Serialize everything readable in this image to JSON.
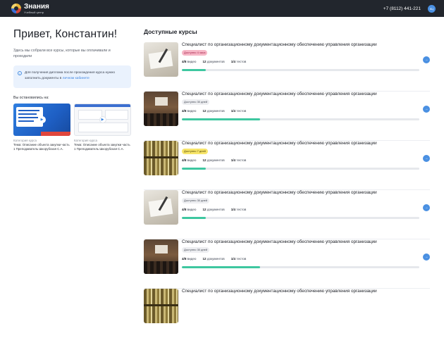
{
  "header": {
    "logo_title": "Знания",
    "logo_subtitle": "Учебный центр",
    "phone": "+7 (8112) 441-221",
    "avatar_initials": "КЦ"
  },
  "sidebar": {
    "greeting": "Привет, Константин!",
    "intro": "Здесь мы собрали все курсы, которые вы оплачивали и проходили",
    "notice_text": "Для получения диплома после прохождения курса нужно заполнить документы в",
    "notice_link": "личном кабинете",
    "stopped_title": "Вы остановились на:",
    "recent": [
      {
        "category": "Категория курса",
        "description": "Тема: Описание объекта закупки часть 1 Преподаватель Шкорубская С.А."
      },
      {
        "category": "Категория курса",
        "description": "Тема: Описание объекта закупки часть 1 Преподаватель Шкорубская С.А."
      }
    ]
  },
  "main": {
    "section_title": "Доступные курсы",
    "courses": [
      {
        "title": "Специалист по организационному документационному обеспечению управления организации",
        "badge": "Доступно 4 часа",
        "videos": "4/8",
        "videos_label": "видео",
        "docs": "12",
        "docs_label": "документов",
        "tests": "1/4",
        "tests_label": "тестов",
        "progress": 0.1
      },
      {
        "title": "Специалист по организационному документационному обеспечению управления организации",
        "badge": "Доступно 30 дней",
        "videos": "4/8",
        "videos_label": "видео",
        "docs": "12",
        "docs_label": "документов",
        "tests": "1/4",
        "tests_label": "тестов",
        "progress": 0.33
      },
      {
        "title": "Специалист по организационному документационному обеспечению управления организации",
        "badge": "Доступно 7 дней",
        "videos": "4/8",
        "videos_label": "видео",
        "docs": "12",
        "docs_label": "документов",
        "tests": "1/4",
        "tests_label": "тестов",
        "progress": 0.1
      },
      {
        "title": "Специалист по организационному документационному обеспечению управления организации",
        "badge": "Доступно 30 дней",
        "videos": "4/8",
        "videos_label": "видео",
        "docs": "12",
        "docs_label": "документов",
        "tests": "1/4",
        "tests_label": "тестов",
        "progress": 0.1
      },
      {
        "title": "Специалист по организационному документационному обеспечению управления организации",
        "badge": "Доступно 30 дней",
        "videos": "4/8",
        "videos_label": "видео",
        "docs": "12",
        "docs_label": "документов",
        "tests": "1/4",
        "tests_label": "тестов",
        "progress": 0.33
      },
      {
        "title": "Специалист по организационному документационному обеспечению управления организации"
      }
    ]
  },
  "colors": {
    "accent": "#4a90e2",
    "progress": "#3ec7a0",
    "header_bg": "#22262d",
    "notice_bg": "#eaf2fd"
  }
}
